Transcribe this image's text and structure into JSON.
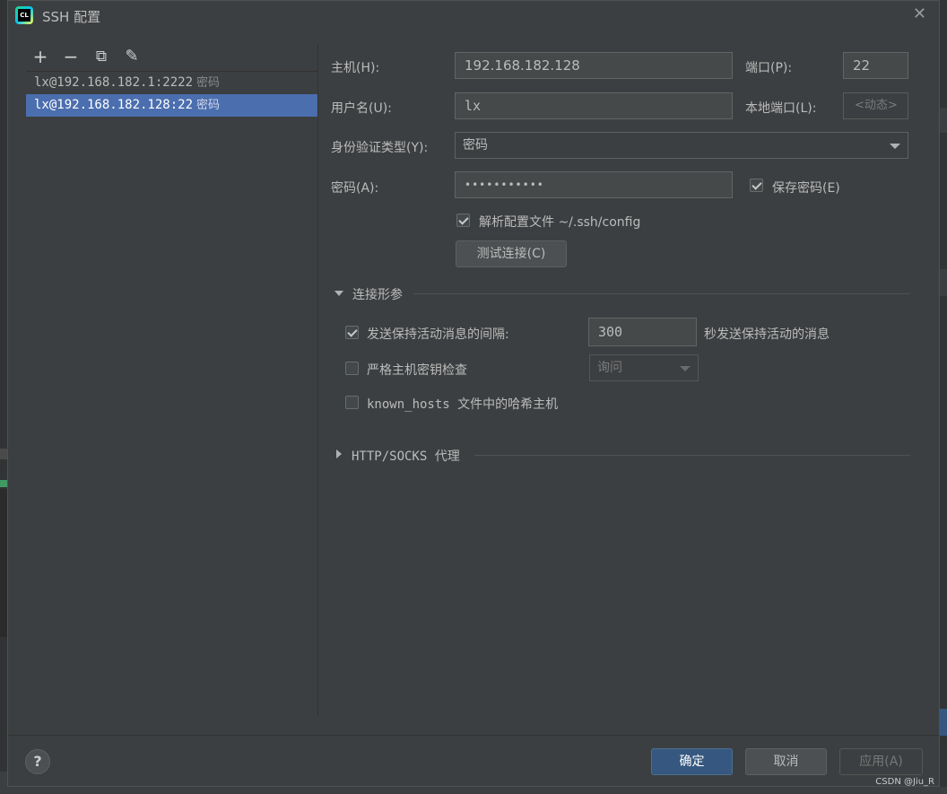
{
  "window": {
    "title": "SSH 配置",
    "app_icon_text": "CL"
  },
  "toolbar": {
    "add": "+",
    "remove": "−",
    "copy": "⧉",
    "edit": "✎"
  },
  "hosts": [
    {
      "name": "lx@192.168.182.1:2222",
      "auth": "密码",
      "selected": false
    },
    {
      "name": "lx@192.168.182.128:22",
      "auth": "密码",
      "selected": true
    }
  ],
  "form": {
    "host_label": "主机(H):",
    "host_value": "192.168.182.128",
    "port_label": "端口(P):",
    "port_value": "22",
    "username_label": "用户名(U):",
    "username_value": "lx",
    "local_port_label": "本地端口(L):",
    "local_port_placeholder": "<动态>",
    "auth_type_label": "身份验证类型(Y):",
    "auth_type_value": "密码",
    "password_label": "密码(A):",
    "password_value": "•••••••••••",
    "save_password_label": "保存密码(E)",
    "save_password_checked": true,
    "parse_config_label": "解析配置文件 ~/.ssh/config",
    "parse_config_checked": true,
    "test_connection_label": "测试连接(C)"
  },
  "connection_params": {
    "title": "连接形参",
    "keepalive_label": "发送保持活动消息的间隔:",
    "keepalive_checked": true,
    "keepalive_value": "300",
    "keepalive_suffix": "秒发送保持活动的消息",
    "strict_host_label": "严格主机密钥检查",
    "strict_host_checked": false,
    "strict_host_value": "询问",
    "known_hosts_label": "known_hosts 文件中的哈希主机",
    "known_hosts_checked": false
  },
  "proxy": {
    "title": "HTTP/SOCKS 代理"
  },
  "footer": {
    "help": "?",
    "ok": "确定",
    "cancel": "取消",
    "apply": "应用(A)"
  },
  "watermark": "CSDN @Jiu_R"
}
